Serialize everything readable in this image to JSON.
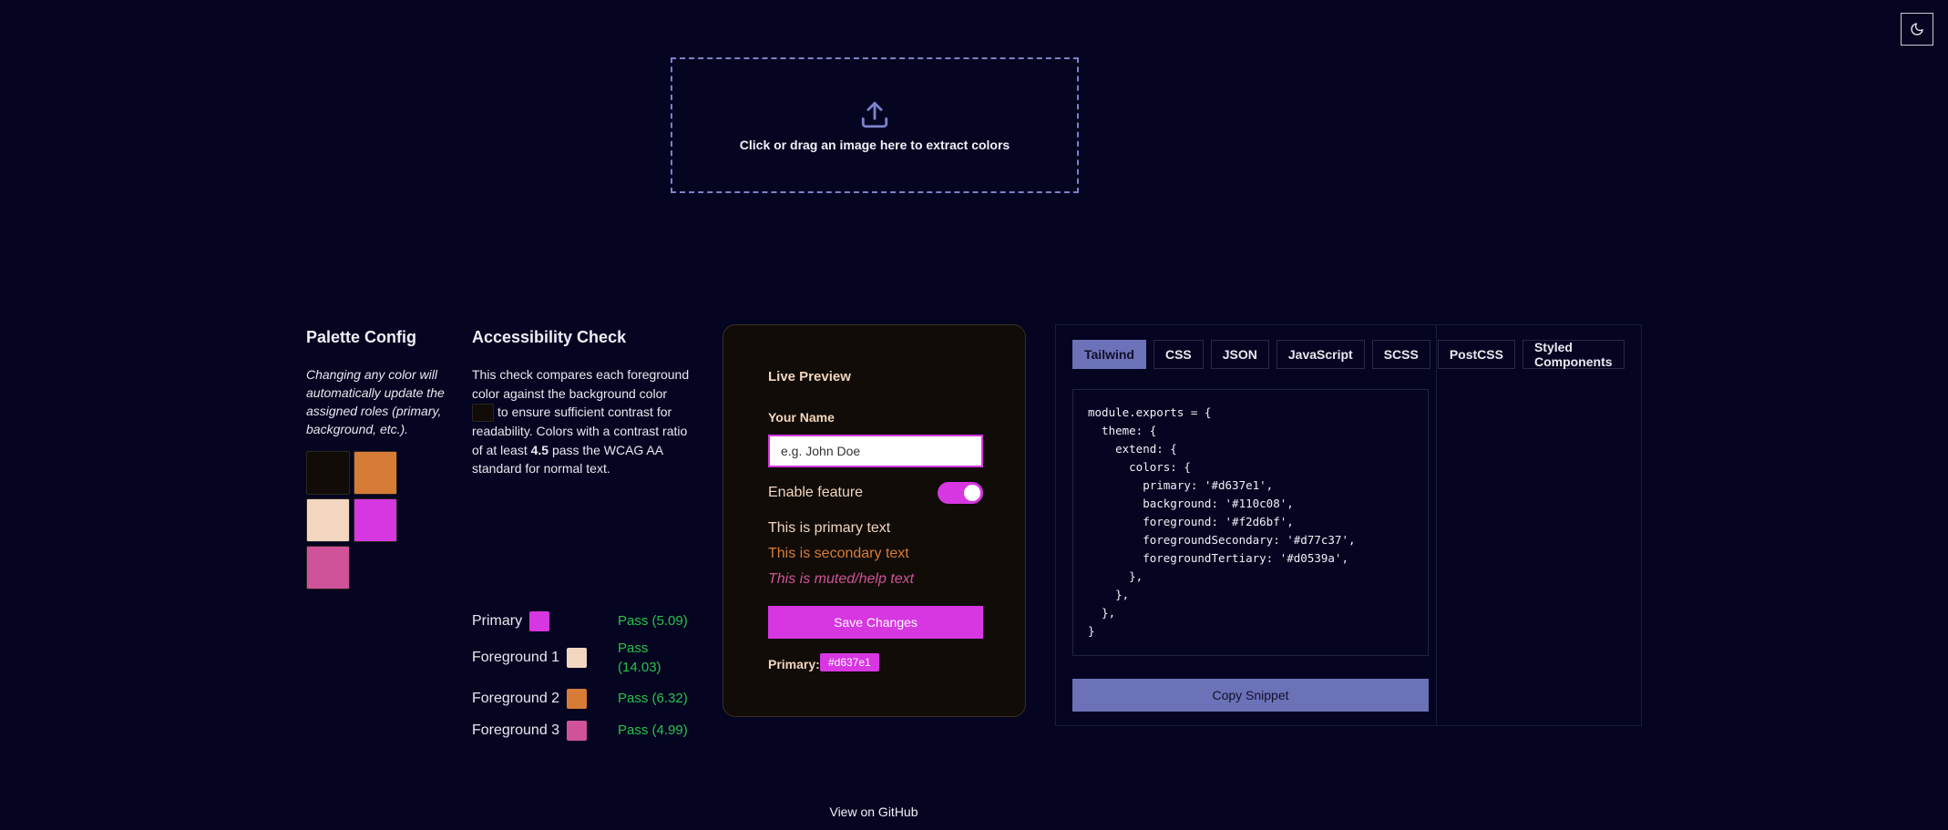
{
  "theme_toggle": {
    "icon": "moon-icon"
  },
  "upload": {
    "icon": "upload-icon",
    "label": "Click or drag an image here to extract colors"
  },
  "palette_config": {
    "title": "Palette Config",
    "description": "Changing any color will automatically update the assigned roles (primary, background, etc.).",
    "swatches": [
      "#110c08",
      "#d77c37",
      "#f2d6bf",
      "#d637e1",
      "#d0539a"
    ]
  },
  "accessibility": {
    "title": "Accessibility Check",
    "desc_part1": "This check compares each foreground color against the background color",
    "desc_part2": "to ensure sufficient contrast for readability. Colors with a contrast ratio of at least",
    "ratio": "4.5",
    "desc_part3": "pass the WCAG AA standard for normal text.",
    "background_color": "#110c08",
    "rows": [
      {
        "name": "Primary",
        "color": "#d637e1",
        "result": "Pass (5.09)"
      },
      {
        "name": "Foreground 1",
        "color": "#f2d6bf",
        "result": "Pass (14.03)"
      },
      {
        "name": "Foreground 2",
        "color": "#d77c37",
        "result": "Pass (6.32)"
      },
      {
        "name": "Foreground 3",
        "color": "#d0539a",
        "result": "Pass (4.99)"
      }
    ],
    "pass_color": "#27c24a"
  },
  "preview": {
    "title": "Live Preview",
    "name_label": "Your Name",
    "name_placeholder": "e.g. John Doe",
    "toggle_label": "Enable feature",
    "toggle_on": true,
    "primary_text": "This is primary text",
    "secondary_text": "This is secondary text",
    "muted_text": "This is muted/help text",
    "save_label": "Save Changes",
    "primary_label": "Primary:",
    "primary_value": "#d637e1",
    "colors": {
      "primary": "#d637e1",
      "background": "#110c08",
      "foreground": "#f2d6bf",
      "secondary": "#d77c37",
      "muted": "#d0539a"
    }
  },
  "code": {
    "tabs": [
      "Tailwind",
      "CSS",
      "JSON",
      "JavaScript",
      "SCSS",
      "PostCSS",
      "Styled Components"
    ],
    "active_tab": "Tailwind",
    "snippet": "module.exports = {\n  theme: {\n    extend: {\n      colors: {\n        primary: '#d637e1',\n        background: '#110c08',\n        foreground: '#f2d6bf',\n        foregroundSecondary: '#d77c37',\n        foregroundTertiary: '#d0539a',\n      },\n    },\n  },\n}",
    "copy_label": "Copy Snippet",
    "accent": "#6c72b8"
  },
  "footer": {
    "github_label": "View on GitHub"
  }
}
